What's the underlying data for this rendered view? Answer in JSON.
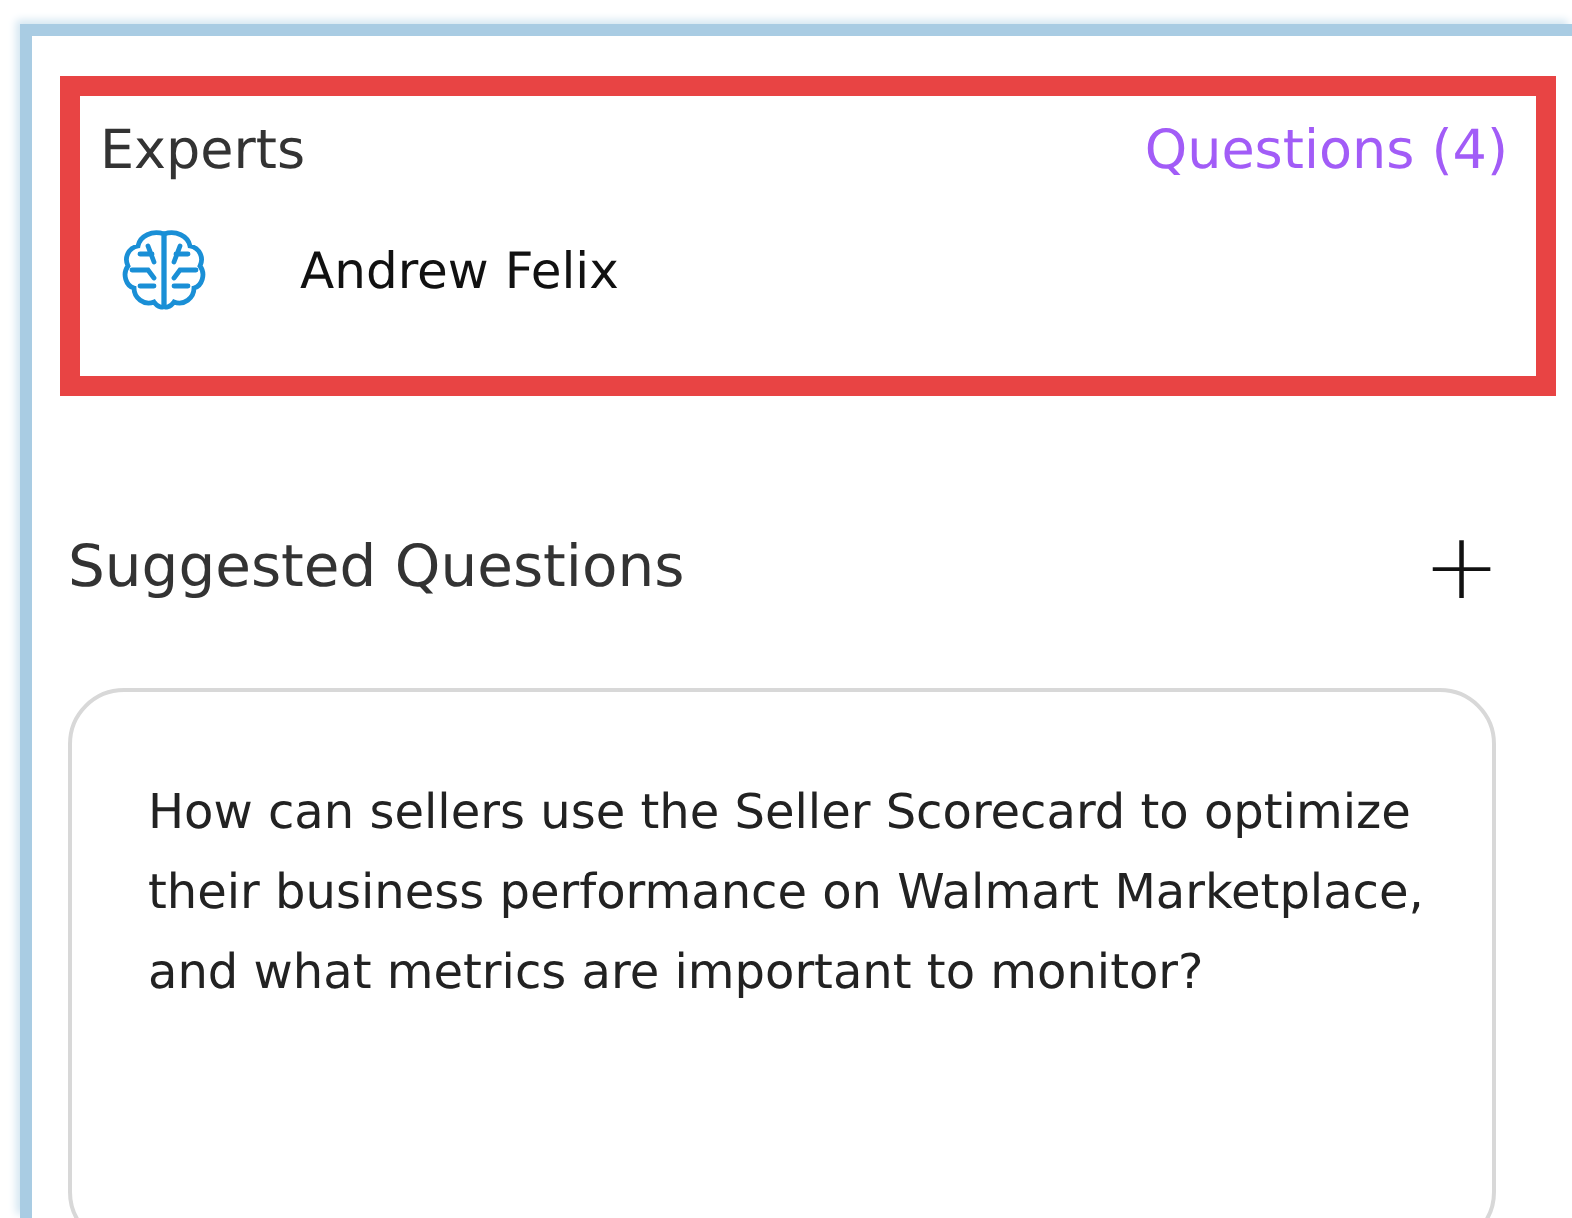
{
  "experts": {
    "highlighted": true,
    "title": "Experts",
    "questions_link": "Questions (4)",
    "items": [
      {
        "name": "Andrew Felix"
      }
    ]
  },
  "suggested": {
    "title": "Suggested Questions",
    "add_icon": "+",
    "questions": [
      "How can sellers use the Seller Scorecard to optimize their business performance on Walmart Marketplace, and what metrics are important to monitor?"
    ]
  }
}
